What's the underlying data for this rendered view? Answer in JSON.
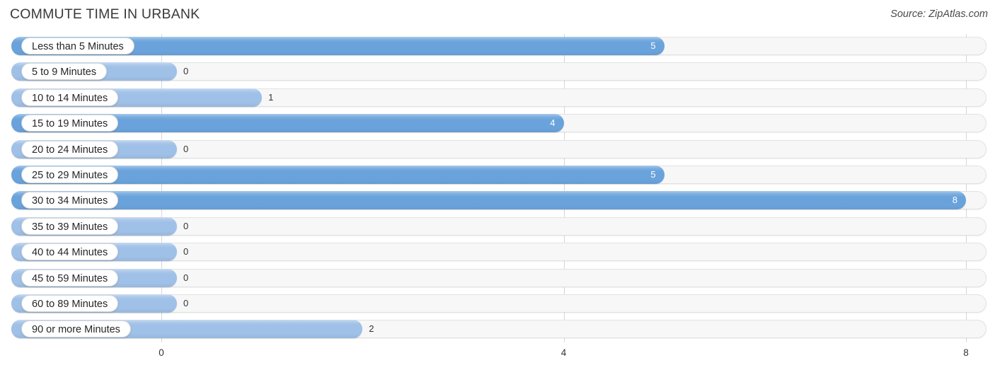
{
  "header": {
    "title": "COMMUTE TIME IN URBANK",
    "source": "Source: ZipAtlas.com"
  },
  "colors": {
    "bar_high": "#6aa3dc",
    "bar_low": "#9fc0e7",
    "track": "#f7f7f7",
    "gridline": "#d6d6d6",
    "text": "#333333",
    "value_inside": "#ffffff"
  },
  "chart_data": {
    "type": "bar",
    "orientation": "horizontal",
    "title": "COMMUTE TIME IN URBANK",
    "xlabel": "",
    "ylabel": "",
    "xlim": [
      0,
      8
    ],
    "xticks": [
      0,
      4,
      8
    ],
    "xtick_labels": [
      "0",
      "4",
      "8"
    ],
    "grid": true,
    "legend": null,
    "categories": [
      "Less than 5 Minutes",
      "5 to 9 Minutes",
      "10 to 14 Minutes",
      "15 to 19 Minutes",
      "20 to 24 Minutes",
      "25 to 29 Minutes",
      "30 to 34 Minutes",
      "35 to 39 Minutes",
      "40 to 44 Minutes",
      "45 to 59 Minutes",
      "60 to 89 Minutes",
      "90 or more Minutes"
    ],
    "values": [
      5,
      0,
      1,
      4,
      0,
      5,
      8,
      0,
      0,
      0,
      0,
      2
    ],
    "value_labels": [
      "5",
      "0",
      "1",
      "4",
      "0",
      "5",
      "8",
      "0",
      "0",
      "0",
      "0",
      "2"
    ]
  }
}
